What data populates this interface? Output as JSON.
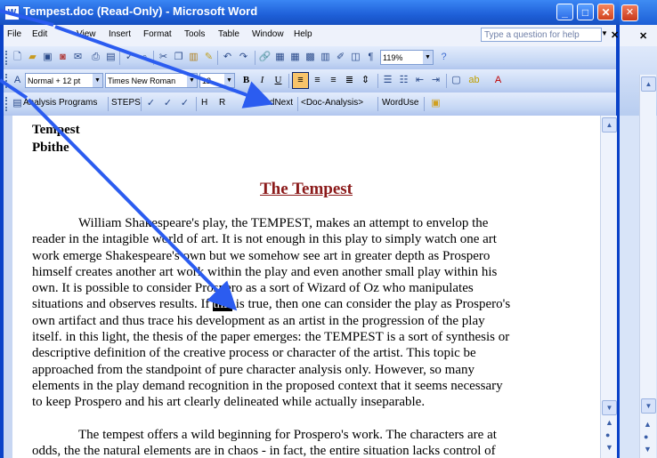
{
  "window": {
    "title": "Tempest.doc (Read-Only) - Microsoft Word",
    "app_icon": "W"
  },
  "menu": {
    "items": [
      "File",
      "Edit",
      "View",
      "Insert",
      "Format",
      "Tools",
      "Table",
      "Window",
      "Help"
    ],
    "ask_placeholder": "Type a question for help"
  },
  "formatting": {
    "style": "Normal + 12 pt",
    "font": "Times New Roman",
    "size": "12",
    "zoom": "119%"
  },
  "custom_toolbar": {
    "analysis_programs": "Analysis Programs",
    "steps": "STEPS",
    "h": "H",
    "r": "R",
    "findnext": "FindNext",
    "doc_analysis": "<Doc-Analysis>",
    "worduse": "WordUse"
  },
  "document": {
    "heading_line1": "Tempest",
    "heading_line2": "Pbithe",
    "title": "The Tempest",
    "para1": [
      "William Shakespeare's play, the TEMPEST, makes an attempt to envelop the",
      "reader in the intagible world of art.  It is not enough in this play to simply watch one art",
      "work emerge Shakespeare's own but we somehow see art in greater depth as Prospero",
      "himself creates another art work within the play and even another small play within his",
      "own.  It is possible to consider Prospero as a sort of Wizard of Oz who manipulates",
      "situations and observes results.  If ",
      "own artifact and thus trace his development as an artist in the progression of the play",
      "itself.  in this light, the thesis of the paper emerges: the TEMPEST is a sort of synthesis or",
      "descriptive definition of the creative process or character of the artist.  This topic be",
      "approached from the standpoint of pure character analysis only.  However, so many",
      "elements in the play demand recognition in the proposed context that it seems necessary",
      "to keep Prospero and his art clearly delineated while actually inseparable."
    ],
    "highlighted_word": "this",
    "line6_after": " is true, then one can consider the play as Prospero's",
    "para2": [
      "The tempest offers a wild beginning for Prospero's work.  The characters are at",
      "odds, the the natural elements are in chaos  - in fact, the entire situation lacks control of"
    ]
  },
  "colors": {
    "title_bar": "#1e5fd8",
    "doc_title": "#8b1a1a",
    "arrow": "#2b5cf0"
  }
}
